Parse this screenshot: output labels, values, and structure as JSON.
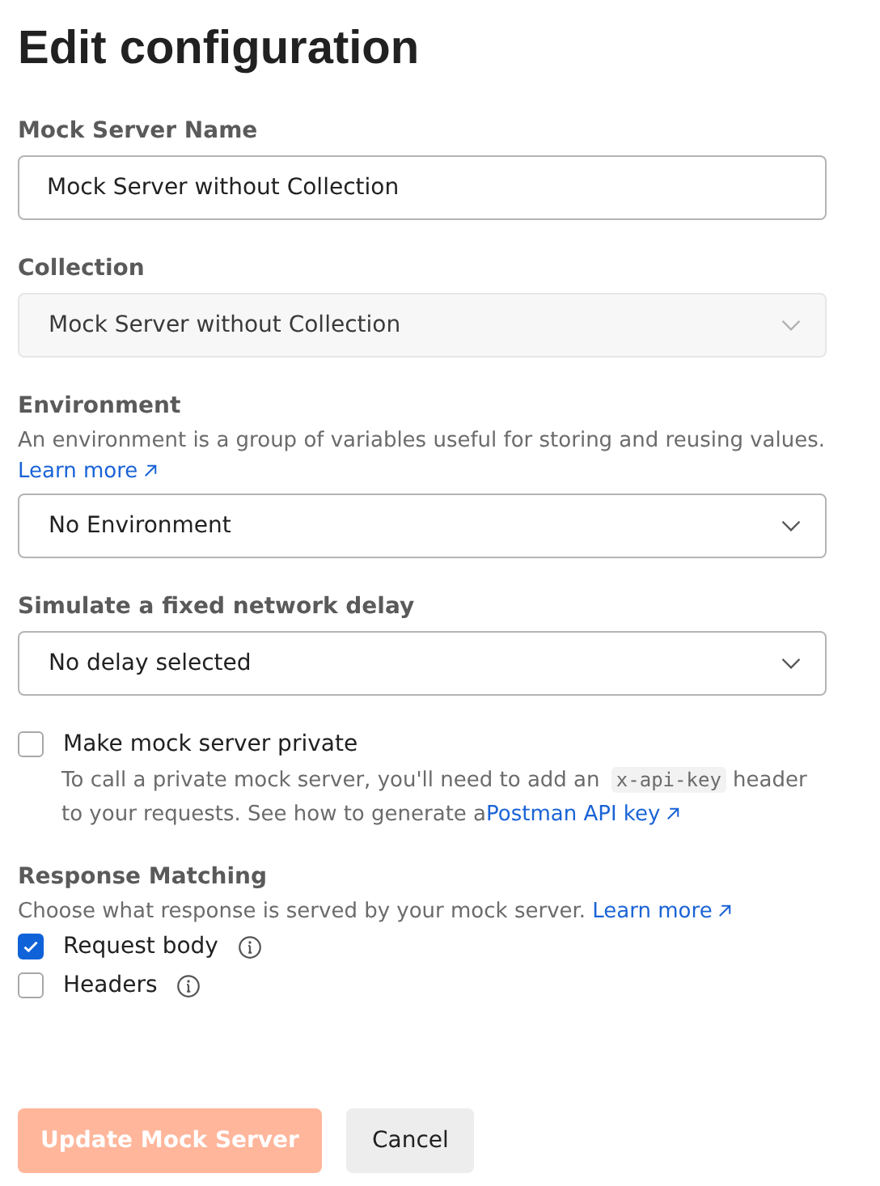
{
  "title": "Edit configuration",
  "fields": [
    {
      "label": "Mock Server Name",
      "kind": "text",
      "value": "Mock Server without Collection",
      "disabled": false
    },
    {
      "label": "Collection",
      "kind": "select",
      "value": "Mock Server without Collection",
      "disabled": true
    },
    {
      "label": "Environment",
      "kind": "select",
      "description": "An environment is a group of variables useful for storing and reusing values.",
      "link": "Learn more",
      "value": "No Environment",
      "disabled": false
    },
    {
      "label": "Simulate a fixed network delay",
      "kind": "select",
      "value": "No delay selected",
      "disabled": false
    }
  ],
  "private": {
    "label": "Make mock server private",
    "checked": false,
    "help_before": "To call a private mock server, you'll need to add an ",
    "code": "x-api-key",
    "help_after": " header to your requests. See how to generate a",
    "link": "Postman API key"
  },
  "response_matching": {
    "title": "Response Matching",
    "description": "Choose what response is served by your mock server.",
    "link": "Learn more",
    "options": [
      {
        "label": "Request body",
        "checked": true
      },
      {
        "label": "Headers",
        "checked": false
      }
    ]
  },
  "buttons": [
    {
      "label": "Update Mock Server",
      "kind": "primary",
      "disabled": true
    },
    {
      "label": "Cancel",
      "kind": "secondary",
      "disabled": false
    }
  ]
}
